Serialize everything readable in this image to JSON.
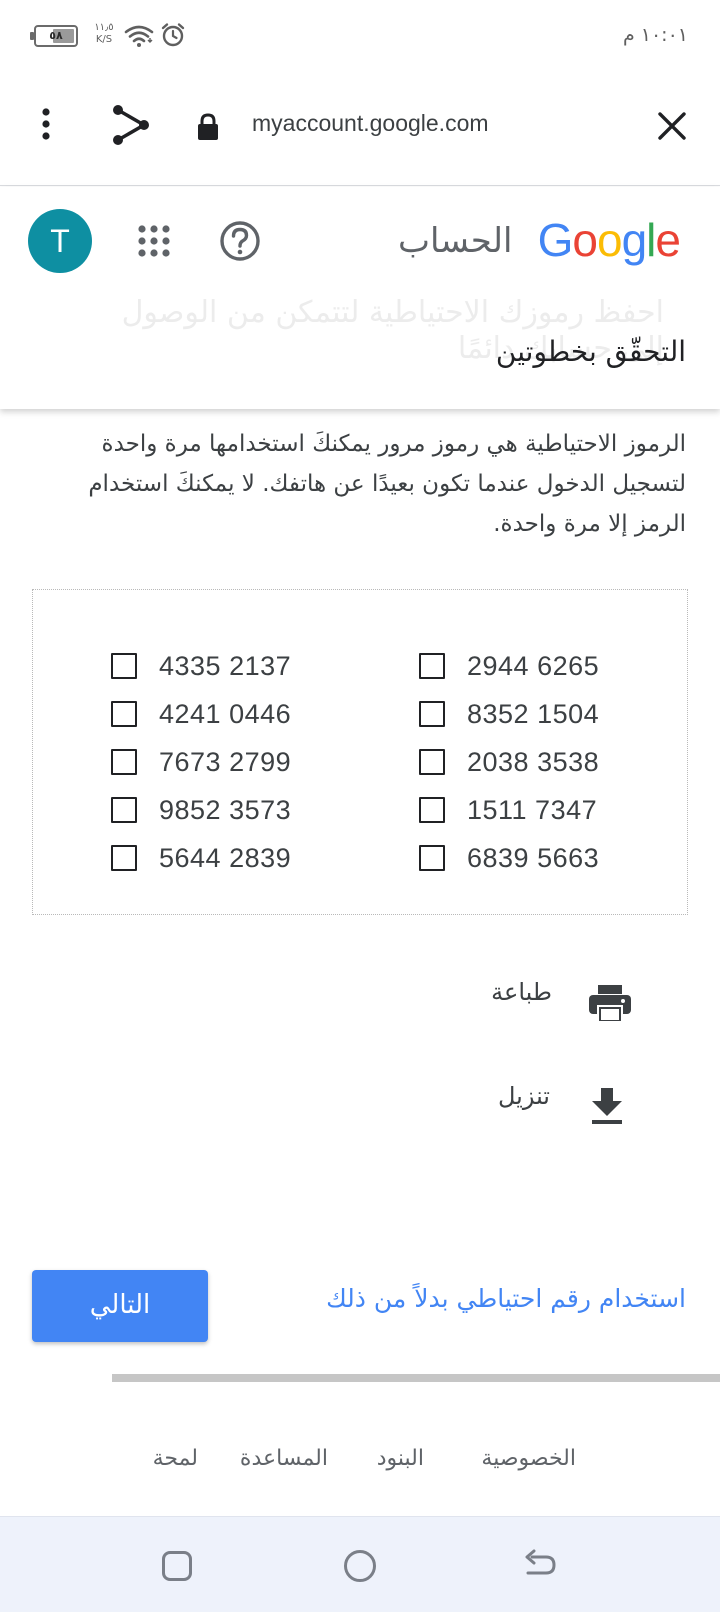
{
  "status_bar": {
    "battery": "٥٨",
    "battery_level": 0.58,
    "net_speed_value": "١١٫٥",
    "net_speed_unit": "K/S",
    "time": "١٠:٠١ م"
  },
  "browser": {
    "url": "myaccount.google.com"
  },
  "header": {
    "avatar_letter": "T",
    "logo_letters": [
      {
        "char": "G",
        "color": "#4285F4"
      },
      {
        "char": "o",
        "color": "#EA4335"
      },
      {
        "char": "o",
        "color": "#FBBC05"
      },
      {
        "char": "g",
        "color": "#4285F4"
      },
      {
        "char": "l",
        "color": "#34A853"
      },
      {
        "char": "e",
        "color": "#EA4335"
      }
    ],
    "label": "الحساب",
    "ghost_text": "احفظ رموزك الاحتياطية لتتمكن من الوصول إلى حسابك دائمًا",
    "page_title": "التحقّق بخطوتين"
  },
  "description": "الرموز الاحتياطية هي رموز مرور يمكنكَ استخدامها مرة واحدة لتسجيل الدخول عندما تكون بعيدًا عن هاتفك. لا يمكنكَ استخدام الرمز إلا مرة واحدة.",
  "codes": {
    "left": [
      "4335 2137",
      "4241 0446",
      "7673 2799",
      "9852 3573",
      "5644 2839"
    ],
    "right": [
      "2944 6265",
      "8352 1504",
      "2038 3538",
      "1511 7347",
      "6839 5663"
    ]
  },
  "actions": {
    "print_label": "طباعة",
    "download_label": "تنزيل"
  },
  "buttons": {
    "next_label": "التالي",
    "alt_link": "استخدام رقم احتياطي بدلاً من ذلك"
  },
  "footer": {
    "privacy": "الخصوصية",
    "terms": "البنود",
    "help": "المساعدة",
    "about": "لمحة"
  },
  "colors": {
    "accent": "#4285F4",
    "avatar": "#0E8FA2"
  }
}
